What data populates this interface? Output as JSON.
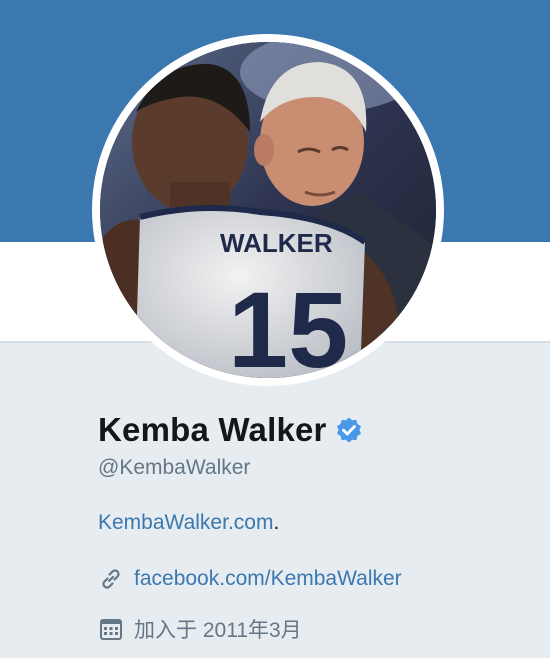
{
  "profile": {
    "name": "Kemba Walker",
    "handle": "@KembaWalker",
    "bio_link": "KembaWalker.com",
    "bio_suffix": ".",
    "website": "facebook.com/KembaWalker",
    "joined": "加入于 2011年3月",
    "jersey_name": "WALKER",
    "jersey_number": "15"
  },
  "icons": {
    "verified": "verified-badge-icon",
    "link": "link-icon",
    "calendar": "calendar-icon"
  },
  "colors": {
    "banner": "#3b78b0",
    "link": "#3b78b0",
    "verified": "#4a99e9",
    "muted": "#657786",
    "text": "#14171a"
  }
}
